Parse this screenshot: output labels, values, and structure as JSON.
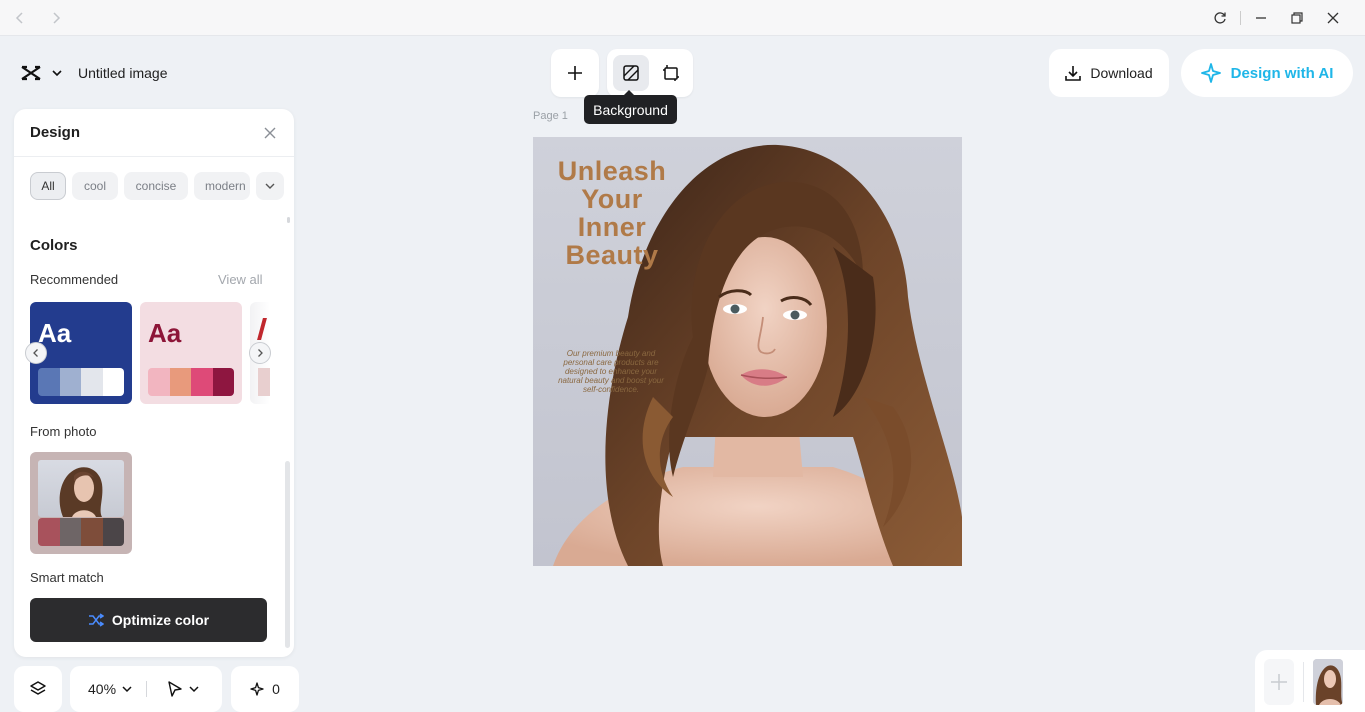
{
  "app": {
    "title": "Untitled image"
  },
  "toolbar": {
    "tooltip": "Background",
    "download_label": "Download",
    "ai_label": "Design with AI"
  },
  "canvas": {
    "page_label": "Page 1",
    "headline": "Unleash Your Inner Beauty",
    "body_copy": "Our premium beauty and personal care products are designed to enhance your natural beauty and boost your self-confidence."
  },
  "design_panel": {
    "title": "Design",
    "filters": [
      "All",
      "cool",
      "concise",
      "modern"
    ],
    "colors_title": "Colors",
    "recommended_label": "Recommended",
    "view_all": "View all",
    "palettes": [
      {
        "sample": "Aa",
        "bg": "#233c8e",
        "text": "#ffffff",
        "colors": [
          "#5a77b5",
          "#9fb0d0",
          "#e3e6ec",
          "#ffffff"
        ]
      },
      {
        "sample": "Aa",
        "bg": "#f3dde2",
        "text": "#8d1538",
        "colors": [
          "#f2b5c0",
          "#e89a7c",
          "#de4a78",
          "#8e1640"
        ]
      }
    ],
    "from_photo_label": "From photo",
    "photo_palette": [
      "#a8525c",
      "#6e6566",
      "#7e4d3a",
      "#4b4548"
    ],
    "smart_match_label": "Smart match",
    "optimize_label": "Optimize color"
  },
  "bottom": {
    "zoom": "40%",
    "ai_count": "0"
  },
  "colors": {
    "accent": "#1fb6e8",
    "headline": "#b07a48"
  }
}
